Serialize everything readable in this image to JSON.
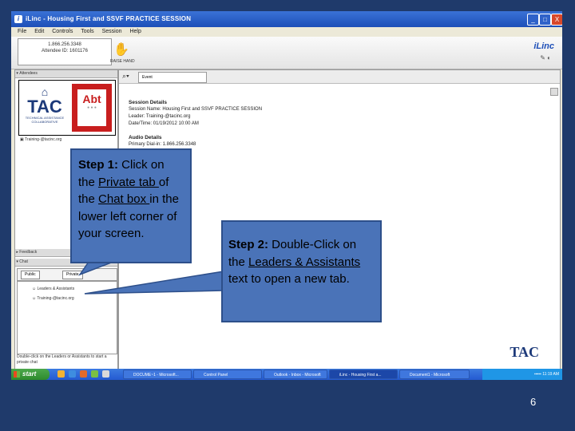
{
  "window": {
    "title": "iLinc - Housing First and SSVF PRACTICE SESSION",
    "controls": [
      "_",
      "□",
      "X"
    ]
  },
  "menu": [
    "File",
    "Edit",
    "Controls",
    "Tools",
    "Session",
    "Help"
  ],
  "toolbar": {
    "conference_line1": "1.866.256.3348",
    "conference_line2": "Attendee ID: 1601176",
    "hand_label": "RAISE HAND",
    "brand": "iLinc"
  },
  "left_panel": {
    "attendees_header": "Attendees",
    "tac_logo": "TAC",
    "tac_logo_sub": "TECHNICAL ASSISTANCE COLLABORATIVE",
    "abt_logo": "Abt",
    "training_email": "Training-@tacinc.org",
    "feedback_header": "Feedback",
    "chat_header": "Chat",
    "chat_tabs": [
      "Public",
      "Private"
    ],
    "participants": [
      "Leaders & Assistants",
      "Training-@tacinc.org"
    ],
    "chat_hint": "Double-click on the Leaders or Assistants to start a private chat"
  },
  "main_panel": {
    "tab_label": "Event",
    "session_details_heading": "Session Details",
    "session_name": "Session Name: Housing First and SSVF PRACTICE SESSION",
    "leader": "Leader: Training-@tacinc.org",
    "date_time": "Date/Time: 01/19/2012 10:00 AM",
    "audio_details_heading": "Audio Details",
    "primary_dialin": "Primary Dial-in: 1.866.256.3348",
    "tac_logo": "TAC"
  },
  "taskbar": {
    "start": "start",
    "buttons": [
      "DOCUME~1 - Microsoft...",
      "Control Panel",
      "Outlook - Inbox - Microsoft",
      "iLinc - Housing First a...",
      "Document1 - Microsoft"
    ],
    "clock": "11:19 AM"
  },
  "callouts": {
    "step1_prefix": "Step 1:",
    "step1_a": " Click on the ",
    "step1_link1": "Private tab ",
    "step1_b": "of the ",
    "step1_link2": "Chat box ",
    "step1_c": "in the lower left corner of your screen.",
    "step2_prefix": "Step 2:",
    "step2_a": " Double-Click on the ",
    "step2_link": "Leaders & Assistants",
    "step2_b": " text to open a new tab."
  },
  "page_number": "6",
  "colors": {
    "slide_bg": "#1f3a6b",
    "callout_fill": "#4a73b8",
    "callout_border": "#2d4f8a"
  }
}
